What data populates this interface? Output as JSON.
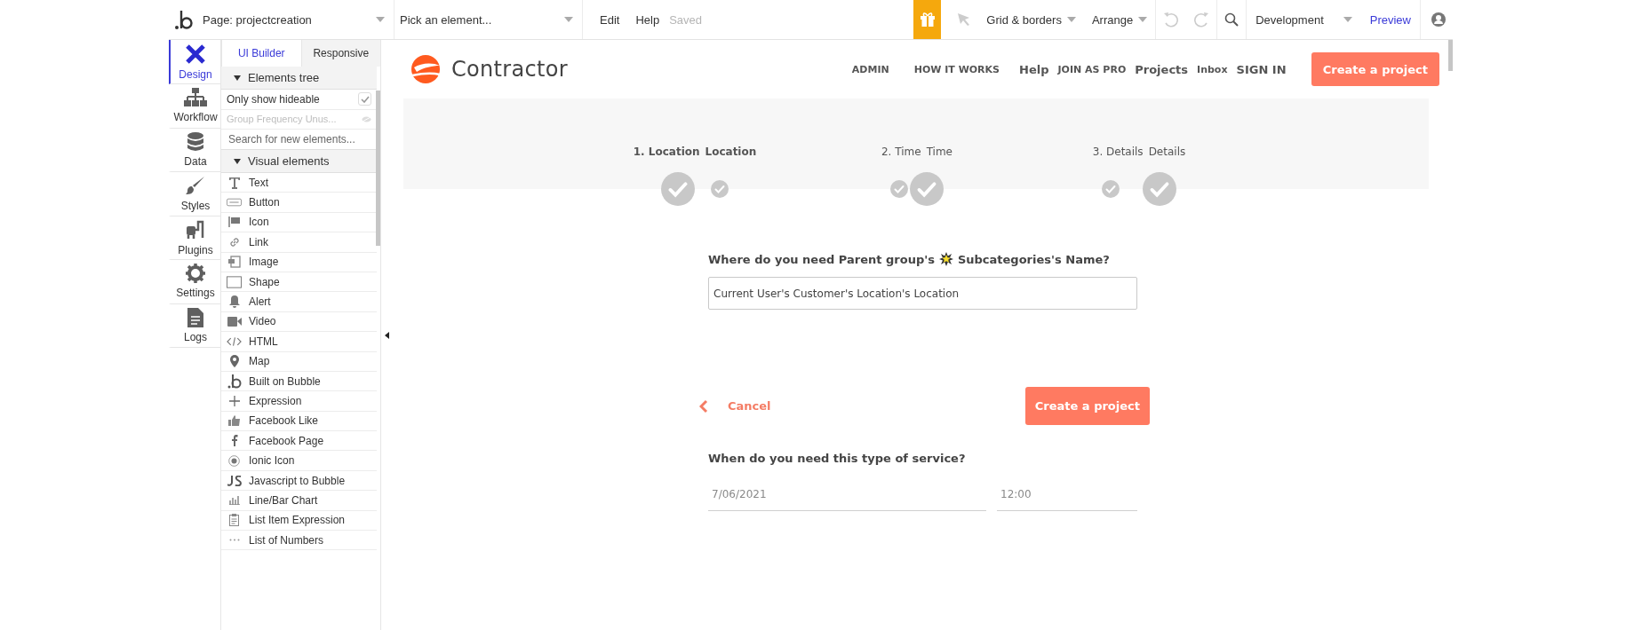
{
  "toolbar": {
    "page_select": "Page: projectcreation",
    "element_select": "Pick an element...",
    "menus": [
      "Edit",
      "Help"
    ],
    "save_status": "Saved",
    "grid_menu": "Grid & borders",
    "arrange_menu": "Arrange",
    "environment": "Development",
    "preview": "Preview"
  },
  "rail": [
    {
      "label": "Design",
      "selected": true
    },
    {
      "label": "Workflow",
      "selected": false
    },
    {
      "label": "Data",
      "selected": false
    },
    {
      "label": "Styles",
      "selected": false
    },
    {
      "label": "Plugins",
      "selected": false
    },
    {
      "label": "Settings",
      "selected": false
    },
    {
      "label": "Logs",
      "selected": false
    }
  ],
  "panel": {
    "tabs": [
      {
        "label": "UI Builder",
        "selected": true
      },
      {
        "label": "Responsive",
        "selected": false
      }
    ],
    "tree": {
      "title": "Elements tree",
      "expanded": true,
      "filter": {
        "label": "Only show hideable",
        "checked": true
      },
      "items": [
        {
          "label": "Group Frequency Unus...",
          "hidden": true
        }
      ]
    },
    "search": {
      "placeholder": "Search for new elements..."
    },
    "visual": {
      "title": "Visual elements",
      "expanded": true,
      "items": [
        "Text",
        "Button",
        "Icon",
        "Link",
        "Image",
        "Shape",
        "Alert",
        "Video",
        "HTML",
        "Map",
        "Built on Bubble",
        "Expression",
        "Facebook Like",
        "Facebook Page",
        "Ionic Icon",
        "Javascript to Bubble",
        "Line/Bar Chart",
        "List Item Expression",
        "List of Numbers"
      ]
    }
  },
  "canvas": {
    "brand": "Contractor",
    "nav": [
      "ADMIN",
      "HOW IT WORKS",
      "Help",
      "JOIN AS PRO",
      "Projects",
      "Inbox",
      "SIGN IN"
    ],
    "header_button": "Create a project",
    "steps": [
      {
        "label": "1. Location",
        "overlay_label": "Location",
        "done": true
      },
      {
        "label": "2. Time",
        "overlay_label": "Time",
        "done": true
      },
      {
        "label": "3. Details",
        "overlay_label": "Details",
        "done": true
      }
    ],
    "question": {
      "before": "Where do you need Parent group's",
      "after": "Subcategories's Name?"
    },
    "location_value": "Current User's Customer's Location's Location",
    "cancel": "Cancel",
    "submit": "Create a project",
    "when_question": "When do you need this type of service?",
    "date_value": "7/06/2021",
    "time_value": "12:00"
  }
}
